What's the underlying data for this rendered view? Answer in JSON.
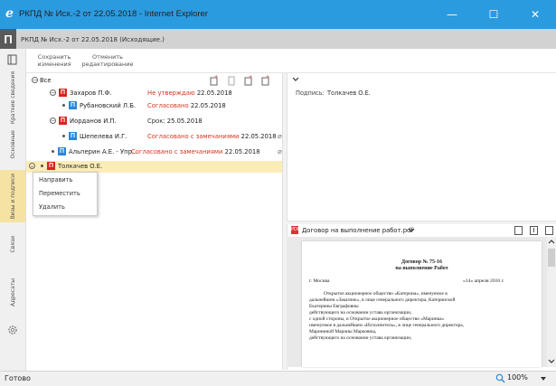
{
  "window": {
    "title": "РКПД № Исх.-2 от 22.05.2018 - Internet Explorer",
    "ie_logo": "e",
    "minimize": "—",
    "maximize": "☐",
    "close": "✕"
  },
  "doc": {
    "icon_letter": "П",
    "title": "РКПД № Исх.-2 от 22.05.2018 (Исходящие.)"
  },
  "toolbar": {
    "save_label": "Сохранить изменения",
    "cancel_label": "Отменить редактирование"
  },
  "rail": {
    "tabs": [
      "Краткие сведения",
      "Основные",
      "Визы и подписи",
      "Связи",
      "Адресаты"
    ]
  },
  "tree": {
    "root_label": "Все",
    "rows": [
      {
        "name": "Захаров П.Ф.",
        "status": "Не утверждаю",
        "date": "22.05.2018"
      },
      {
        "name": "Рубановский Л.Б.",
        "status": "Согласовано",
        "date": "22.05.2018"
      },
      {
        "name": "Иорданов И.П.",
        "status": "Срок:",
        "date": "25.05.2018"
      },
      {
        "name": "Шепелева И.Г.",
        "status": "Согласовано с замечаниями",
        "date": "22.05.2018"
      },
      {
        "name": "Альперин А.Е. - Упр...",
        "status": "Согласовано с замечаниями",
        "date": "22.05.2018"
      },
      {
        "name": "Толкачев О.Е.",
        "status": "",
        "date": ""
      }
    ]
  },
  "context_menu": {
    "items": [
      "Направить",
      "Переместить",
      "Удалить"
    ]
  },
  "signature": {
    "label": "Подпись:",
    "value": "Толкачев О.Е."
  },
  "pdf": {
    "filename": "Договор на выполнение работ.pdf",
    "heading1": "Договор № 75-16",
    "heading2": "на выполнение Работ",
    "city": "г. Москва",
    "date": "«14» апреля 2016 г.",
    "lines": [
      "Открытое акционерное общество «Катерина», именуемое в",
      "дальнейшем «Заказчик», в лице генерального директора, Катеринской",
      "Екатерины Евграфовны",
      "действующего на основании устава организации,",
      "с одной стороны, и Открытое акционерное общество «Маринка»",
      "именуемое в дальнейшем «Исполнитель», в лице генерального директора,",
      "Марининой Марины Марковны,",
      "действующего на основании устава организации,"
    ]
  },
  "status": {
    "text": "Готово",
    "zoom": "100%"
  },
  "colors": {
    "titlebar": "#2b9be0",
    "accent_red": "#d9231d",
    "accent_blue": "#2b87d6",
    "highlight": "#fcedb8"
  }
}
